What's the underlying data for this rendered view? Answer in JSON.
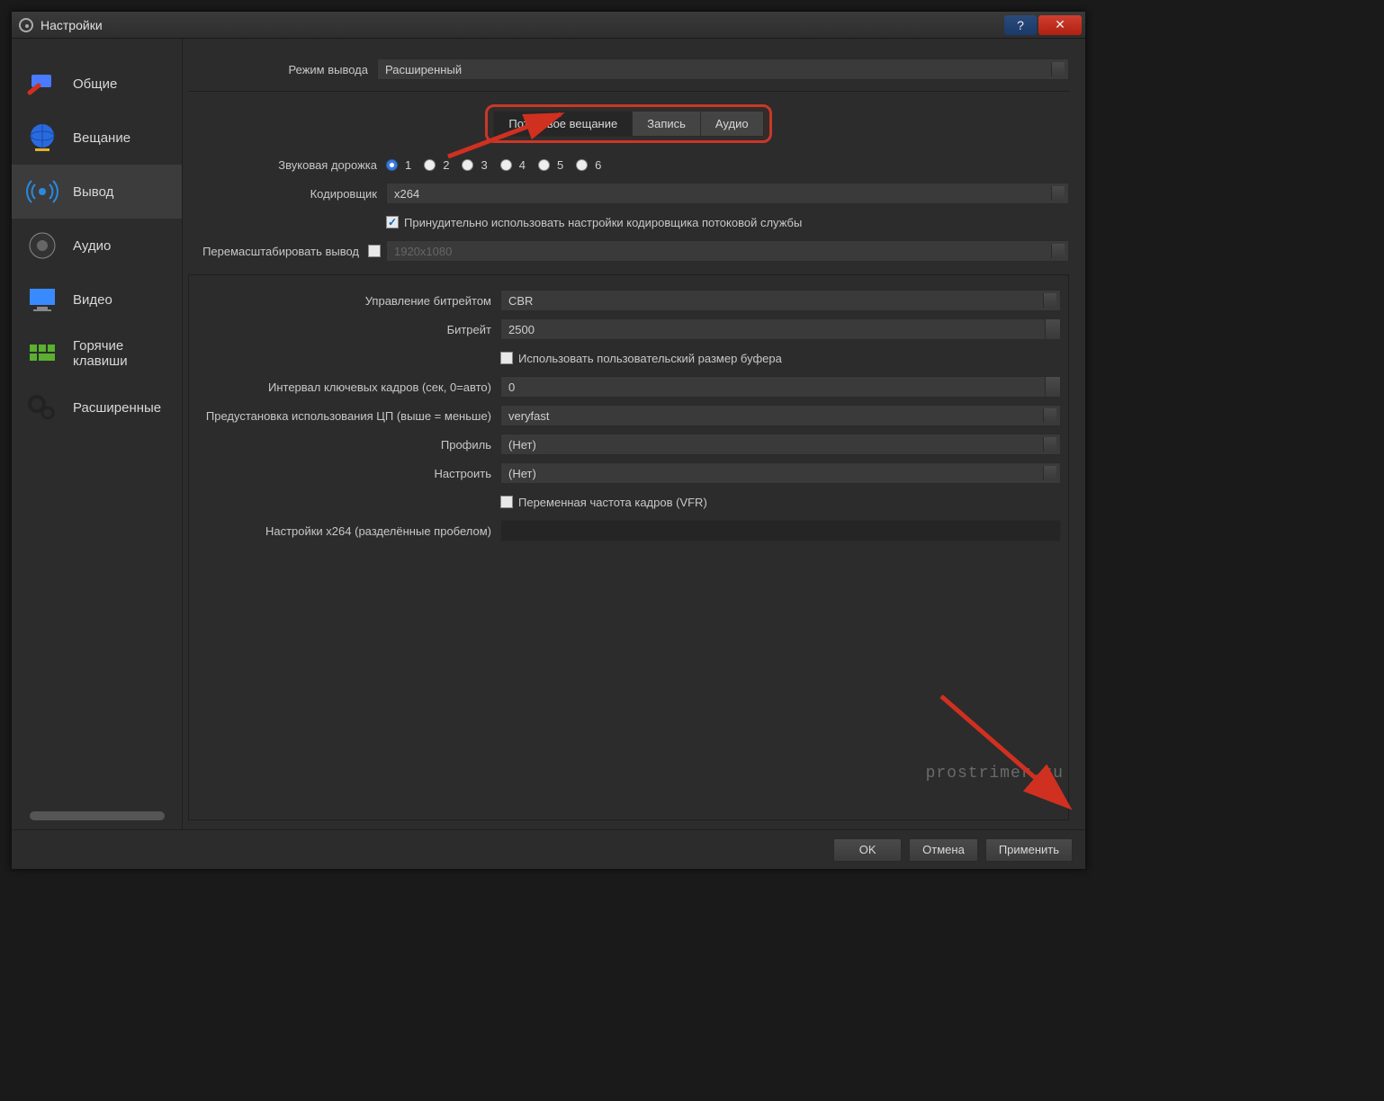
{
  "window": {
    "title": "Настройки"
  },
  "sidebar": {
    "items": [
      {
        "label": "Общие"
      },
      {
        "label": "Вещание"
      },
      {
        "label": "Вывод"
      },
      {
        "label": "Аудио"
      },
      {
        "label": "Видео"
      },
      {
        "label": "Горячие клавиши"
      },
      {
        "label": "Расширенные"
      }
    ],
    "active_index": 2
  },
  "output_mode": {
    "label": "Режим вывода",
    "value": "Расширенный"
  },
  "tabs": {
    "streaming": "Потоковое вещание",
    "recording": "Запись",
    "audio": "Аудио"
  },
  "audio_track": {
    "label": "Звуковая дорожка",
    "options": [
      "1",
      "2",
      "3",
      "4",
      "5",
      "6"
    ],
    "selected": 0
  },
  "encoder": {
    "label": "Кодировщик",
    "value": "x264"
  },
  "enforce_service": {
    "label": "Принудительно использовать настройки кодировщика потоковой службы",
    "checked": true
  },
  "rescale": {
    "label": "Перемасштабировать вывод",
    "checked": false,
    "placeholder": "1920x1080"
  },
  "rate_control": {
    "label": "Управление битрейтом",
    "value": "CBR"
  },
  "bitrate": {
    "label": "Битрейт",
    "value": "2500"
  },
  "custom_buffer": {
    "label": "Использовать пользовательский размер буфера",
    "checked": false
  },
  "keyframe": {
    "label": "Интервал ключевых кадров (сек, 0=авто)",
    "value": "0"
  },
  "cpu_preset": {
    "label": "Предустановка использования ЦП (выше = меньше)",
    "value": "veryfast"
  },
  "profile": {
    "label": "Профиль",
    "value": "(Нет)"
  },
  "tune": {
    "label": "Настроить",
    "value": "(Нет)"
  },
  "vfr": {
    "label": "Переменная частота кадров (VFR)",
    "checked": false
  },
  "x264opts": {
    "label": "Настройки x264 (разделённые пробелом)",
    "value": ""
  },
  "buttons": {
    "ok": "OK",
    "cancel": "Отмена",
    "apply": "Применить"
  },
  "watermark": "prostrimer.ru",
  "colors": {
    "highlight": "#c83828"
  }
}
